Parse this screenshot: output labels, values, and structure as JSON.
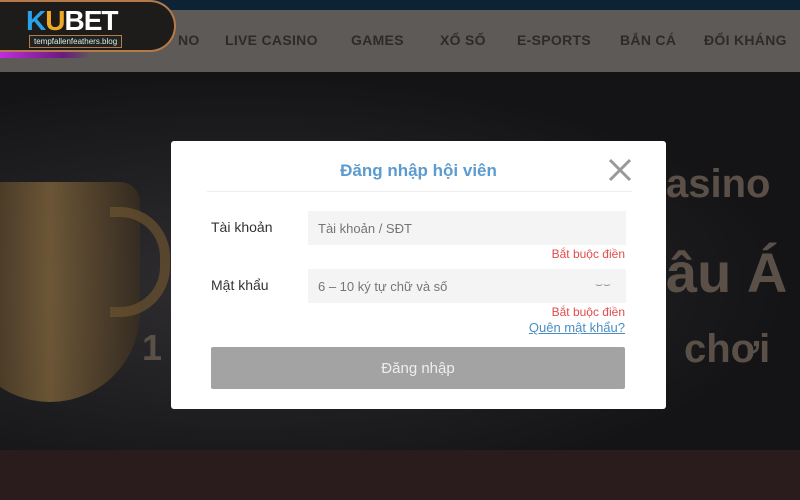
{
  "logo": {
    "brand_k": "K",
    "brand_u": "U",
    "brand_rest": "BET",
    "url": "tempfallenfeathers.blog"
  },
  "nav": {
    "items": [
      "NO",
      "LIVE CASINO",
      "GAMES",
      "XỔ SỐ",
      "E-SPORTS",
      "BẮN CÁ",
      "ĐỔI KHÁNG"
    ]
  },
  "hero": {
    "text1": "asino",
    "text2": "âu Á",
    "text3": "1",
    "text4": "chơi"
  },
  "modal": {
    "title": "Đăng nhập hội viên",
    "close_icon": "close-icon",
    "account_label": "Tài khoản",
    "account_placeholder": "Tài khoản / SĐT",
    "account_error": "Bắt buộc điền",
    "password_label": "Mật khẩu",
    "password_placeholder": "6 – 10 ký tự chữ và số",
    "password_error": "Bắt buộc điền",
    "eye_icon": "eye-closed-icon",
    "forgot_link": "Quên mật khẩu?",
    "submit_label": "Đăng nhập"
  },
  "colors": {
    "title": "#5b9bd0",
    "error": "#e24b4b",
    "link": "#4a8fc4",
    "button": "#a3a3a3"
  }
}
